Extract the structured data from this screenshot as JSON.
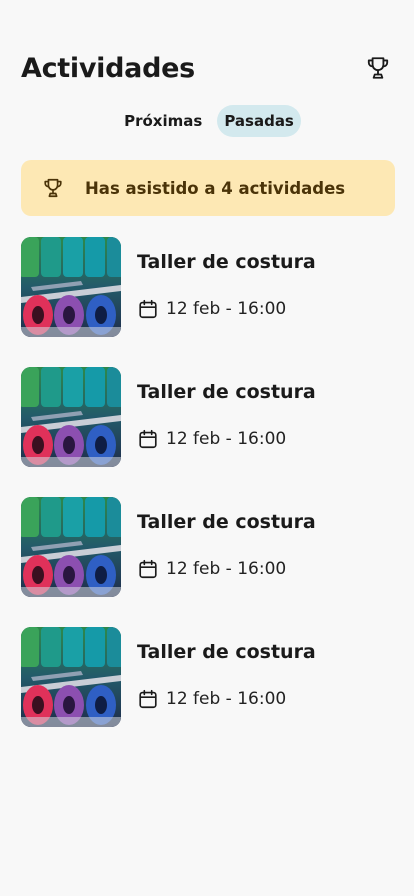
{
  "header": {
    "title": "Actividades",
    "trophy_icon": "trophy-icon"
  },
  "tabs": [
    {
      "label": "Próximas",
      "active": false
    },
    {
      "label": "Pasadas",
      "active": true
    }
  ],
  "banner": {
    "text": "Has asistido a 4 actividades",
    "icon": "trophy-icon",
    "background": "#fde8b4"
  },
  "activities": [
    {
      "title": "Taller de costura",
      "date": "12 feb - 16:00",
      "image": "sewing-threads"
    },
    {
      "title": "Taller de costura",
      "date": "12 feb - 16:00",
      "image": "sewing-threads"
    },
    {
      "title": "Taller de costura",
      "date": "12 feb - 16:00",
      "image": "sewing-threads"
    },
    {
      "title": "Taller de costura",
      "date": "12 feb - 16:00",
      "image": "sewing-threads"
    }
  ],
  "colors": {
    "active_tab": "#d3e9ee",
    "background": "#f8f8f8"
  }
}
